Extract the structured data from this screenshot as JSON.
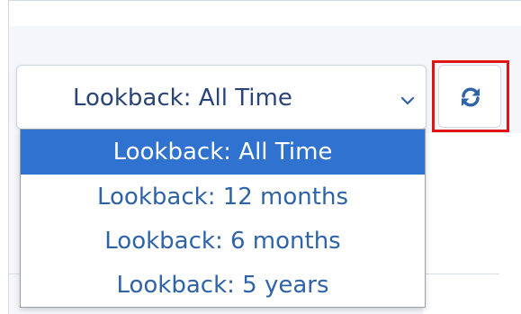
{
  "lookback_select": {
    "selected_label": "Lookback: All Time",
    "options": [
      {
        "label": "Lookback: All Time",
        "selected": true
      },
      {
        "label": "Lookback: 12 months",
        "selected": false
      },
      {
        "label": "Lookback: 6 months",
        "selected": false
      },
      {
        "label": "Lookback: 5 years",
        "selected": false
      }
    ]
  },
  "icons": {
    "dropdown_caret": "chevron-down-icon",
    "refresh": "refresh-icon"
  },
  "colors": {
    "text": "#2b4478",
    "option_text": "#2f63a8",
    "selected_option_bg": "#2f72cf",
    "selected_option_text": "#ffffff",
    "icon": "#2f63a8",
    "highlight": "#e01414"
  }
}
